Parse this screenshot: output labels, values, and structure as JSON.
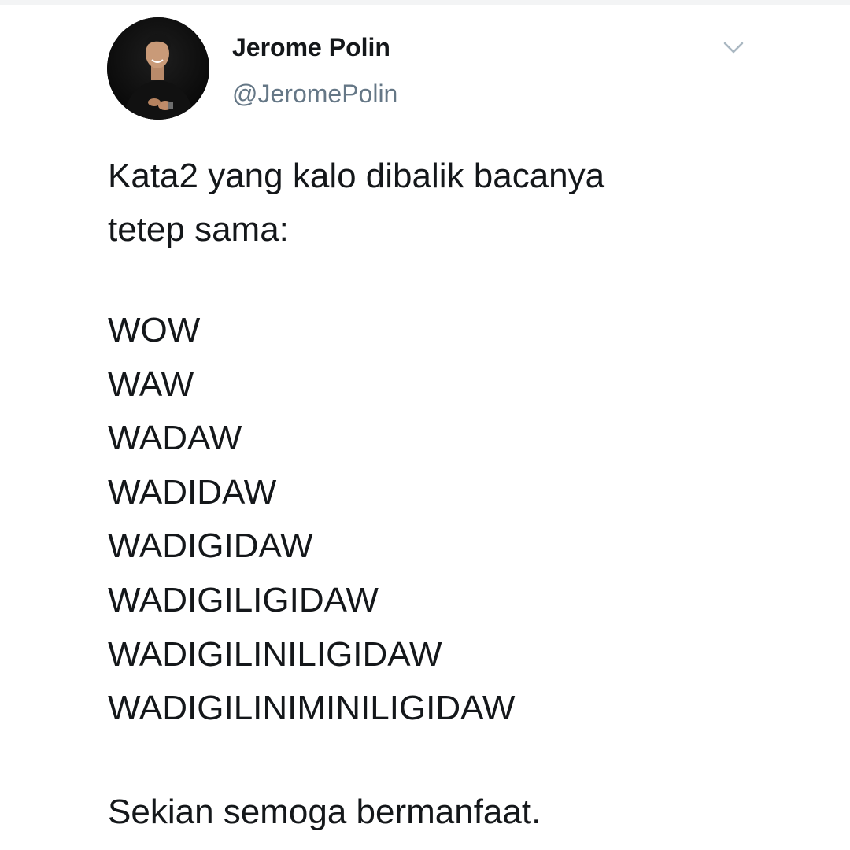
{
  "author": {
    "display_name": "Jerome Polin",
    "handle": "@JeromePolin",
    "avatar_icon": "profile-photo"
  },
  "menu": {
    "icon": "chevron-down-icon"
  },
  "tweet": {
    "intro_lines": [
      "Kata2 yang kalo dibalik bacanya",
      "tetep sama:"
    ],
    "words": [
      "WOW",
      "WAW",
      "WADAW",
      "WADIDAW",
      "WADIGIDAW",
      "WADIGILIGIDAW",
      "WADIGILINILIGIDAW",
      "WADIGILINIMINILIGIDAW"
    ],
    "closing": "Sekian semoga bermanfaat."
  },
  "colors": {
    "text": "#14171a",
    "handle": "#657786",
    "chevron": "#aab8c2",
    "background": "#ffffff"
  }
}
